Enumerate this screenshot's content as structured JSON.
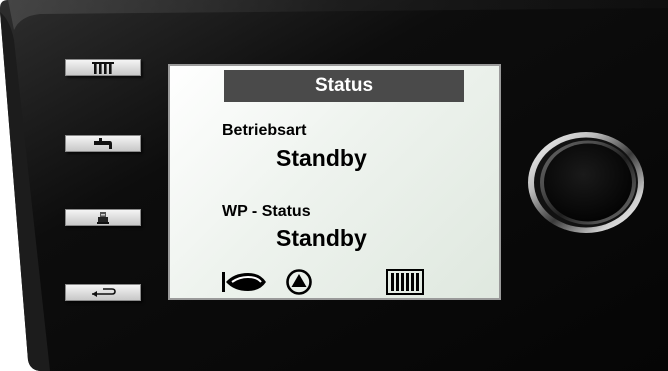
{
  "device": {
    "colors": {
      "bezel": "#0b0b0b",
      "bezel_edge": "#2a2a2a",
      "screen": "#eef3ee",
      "status_bar": "#4a4a4a",
      "button": "#e0e0e0"
    }
  },
  "side_buttons": [
    {
      "icon": "radiator-icon"
    },
    {
      "icon": "faucet-icon"
    },
    {
      "icon": "heat-pump-icon"
    },
    {
      "icon": "return-arrow-icon"
    }
  ],
  "screen": {
    "title": "Status",
    "fields": [
      {
        "label": "Betriebsart",
        "value": "Standby"
      },
      {
        "label": "WP - Status",
        "value": "Standby"
      }
    ],
    "status_icons": [
      "compressor-icon",
      "pump-icon",
      "radiator-icon"
    ]
  },
  "knob": {
    "icon": "rotary-knob"
  }
}
